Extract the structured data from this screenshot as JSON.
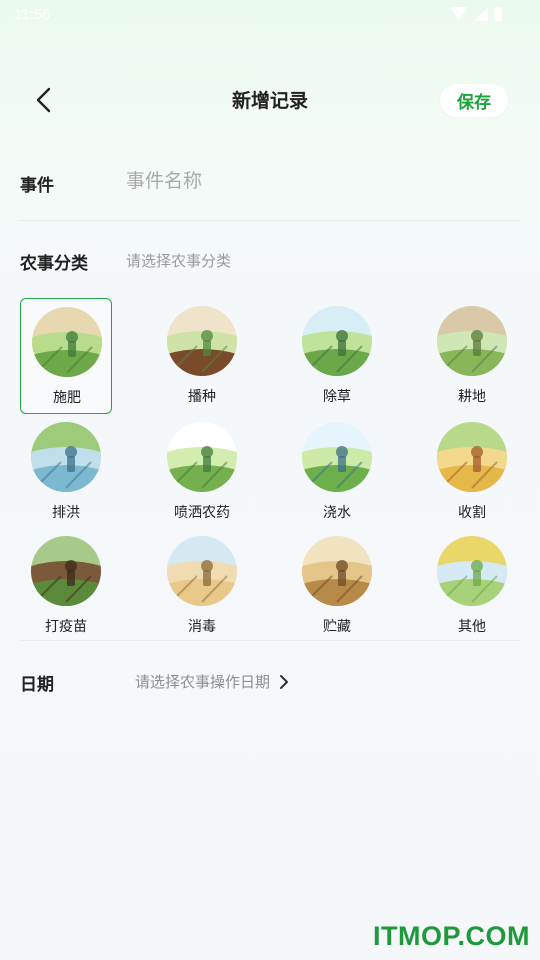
{
  "status_bar": {
    "time": "11:56"
  },
  "nav": {
    "title": "新增记录",
    "save_label": "保存"
  },
  "event": {
    "label": "事件",
    "placeholder": "事件名称"
  },
  "category": {
    "label": "农事分类",
    "hint": "请选择农事分类",
    "selected_index": 0,
    "items": [
      {
        "name": "施肥",
        "icon": "fertilize-icon"
      },
      {
        "name": "播种",
        "icon": "sowing-icon"
      },
      {
        "name": "除草",
        "icon": "weeding-icon"
      },
      {
        "name": "耕地",
        "icon": "plowing-icon"
      },
      {
        "name": "排洪",
        "icon": "drainage-icon"
      },
      {
        "name": "喷洒农药",
        "icon": "spray-pesticide-icon"
      },
      {
        "name": "浇水",
        "icon": "watering-icon"
      },
      {
        "name": "收割",
        "icon": "harvest-icon"
      },
      {
        "name": "打疫苗",
        "icon": "vaccine-icon"
      },
      {
        "name": "消毒",
        "icon": "disinfect-icon"
      },
      {
        "name": "贮藏",
        "icon": "storage-icon"
      },
      {
        "name": "其他",
        "icon": "other-icon"
      }
    ]
  },
  "date": {
    "label": "日期",
    "placeholder": "请选择农事操作日期"
  },
  "watermark": "ITMOP.COM",
  "colors": {
    "accent": "#1aa33c",
    "selected_border": "#21a745"
  }
}
